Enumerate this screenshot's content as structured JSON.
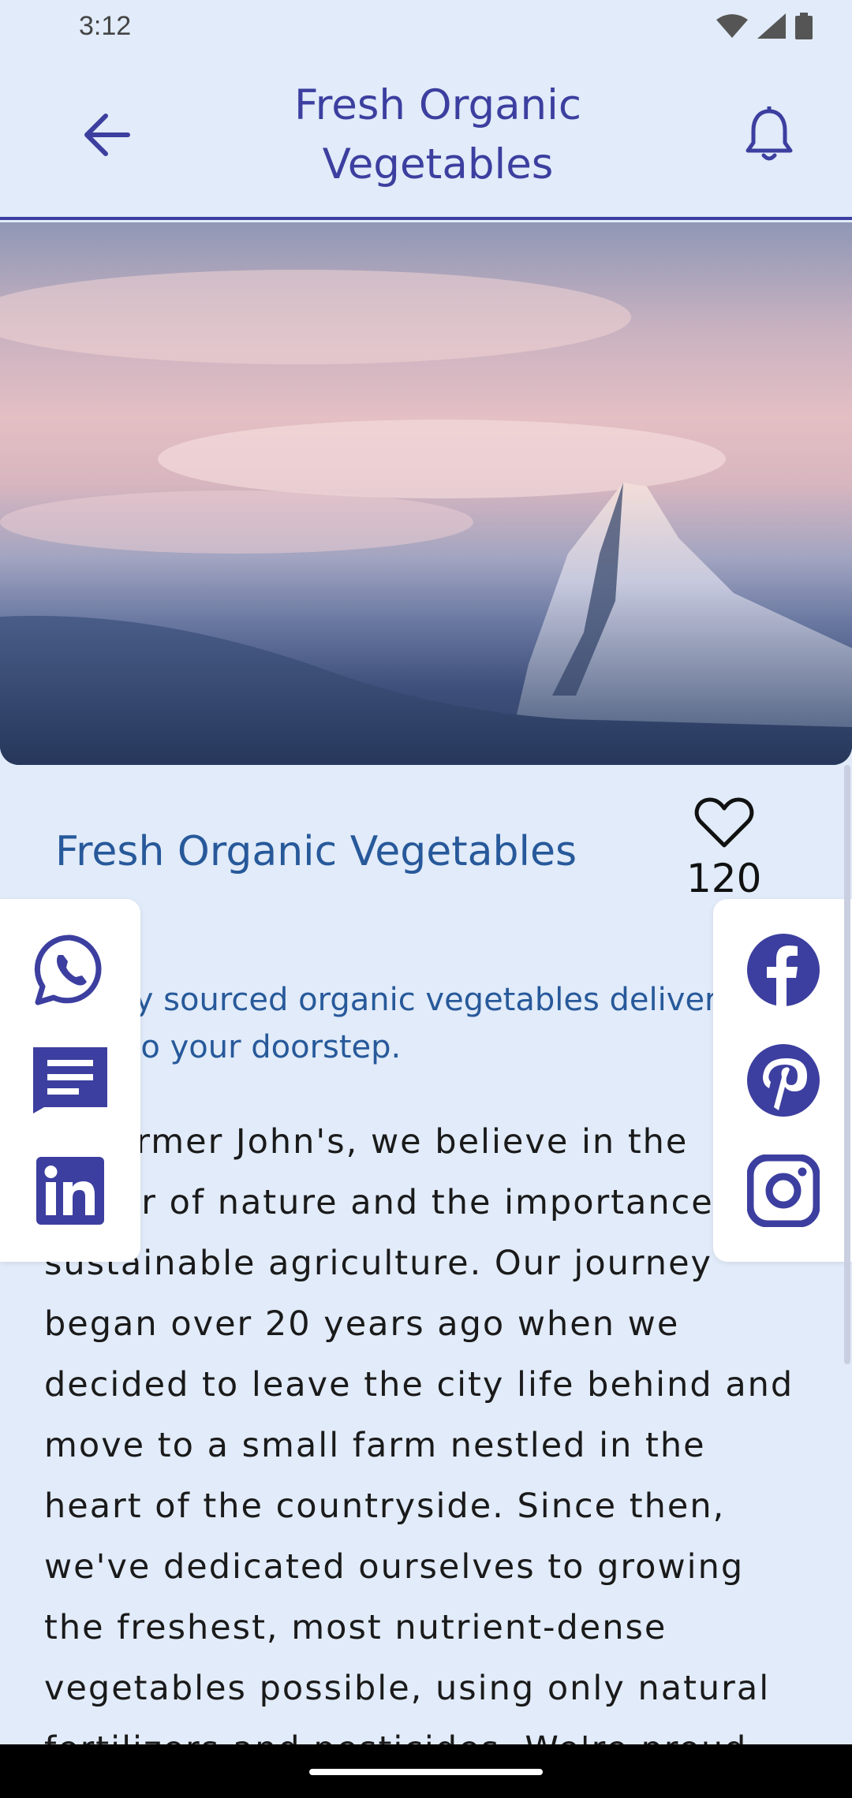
{
  "status_bar": {
    "time": "3:12",
    "icons": [
      "wifi-icon",
      "signal-icon",
      "battery-icon"
    ]
  },
  "app_bar": {
    "title": "Fresh Organic Vegetables",
    "back_icon": "arrow-back-icon",
    "action_icon": "bell-icon"
  },
  "hero": {
    "alt": "mountain-at-sunset-image"
  },
  "post": {
    "title": "Fresh Organic Vegetables",
    "like_count": "120",
    "subtitle": "Locally sourced organic vegetables delivered right to your doorstep.",
    "body": "At Farmer John's, we believe in the power of nature and the importance of sustainable agriculture. Our journey began over 20 years ago when we decided to leave the city life behind and move to a small farm nestled in the heart of the countryside. Since then, we've dedicated ourselves to growing the freshest, most nutrient-dense vegetables possible, using only natural fertilizers and pesticides. We're proud"
  },
  "share": {
    "left": [
      "whatsapp-icon",
      "message-icon",
      "linkedin-icon"
    ],
    "right": [
      "facebook-icon",
      "pinterest-icon",
      "instagram-icon"
    ]
  },
  "colors": {
    "background": "#e1ebf9",
    "accent": "#3c3f9f",
    "title_blue": "#27599a"
  }
}
